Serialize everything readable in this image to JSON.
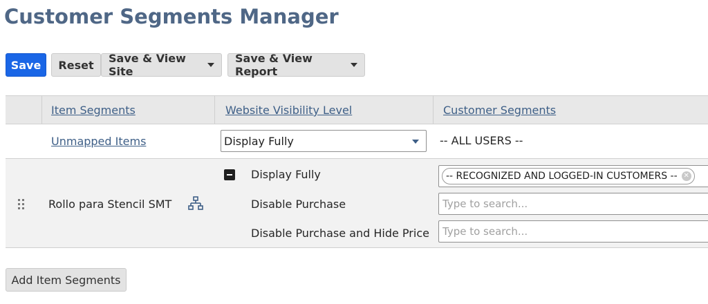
{
  "page": {
    "title": "Customer Segments Manager"
  },
  "toolbar": {
    "save_label": "Save",
    "reset_label": "Reset",
    "save_view_site_label": "Save & View Site",
    "save_view_report_label": "Save & View Report"
  },
  "table": {
    "headers": [
      "Item Segments",
      "Website Visibility Level",
      "Customer Segments"
    ],
    "row1": {
      "item": "Unmapped Items",
      "visibility": "Display Fully",
      "customers": "-- ALL USERS --"
    },
    "row2": {
      "item": "Rollo para Stencil SMT",
      "levels": [
        "Display Fully",
        "Disable Purchase",
        "Disable Purchase and Hide Price"
      ],
      "tag": "-- RECOGNIZED AND LOGGED-IN CUSTOMERS --",
      "search_placeholder": "Type to search..."
    }
  },
  "add_button_label": "Add Item Segments",
  "icons": {
    "drag": "drag-handle-icon",
    "hierarchy": "hierarchy-icon",
    "collapse": "collapse-minus-icon",
    "dropdown": "chevron-down-icon",
    "tag_remove": "close-icon"
  },
  "colors": {
    "title": "#4f6786",
    "primary": "#1a66e6",
    "link": "#3e5f87"
  }
}
